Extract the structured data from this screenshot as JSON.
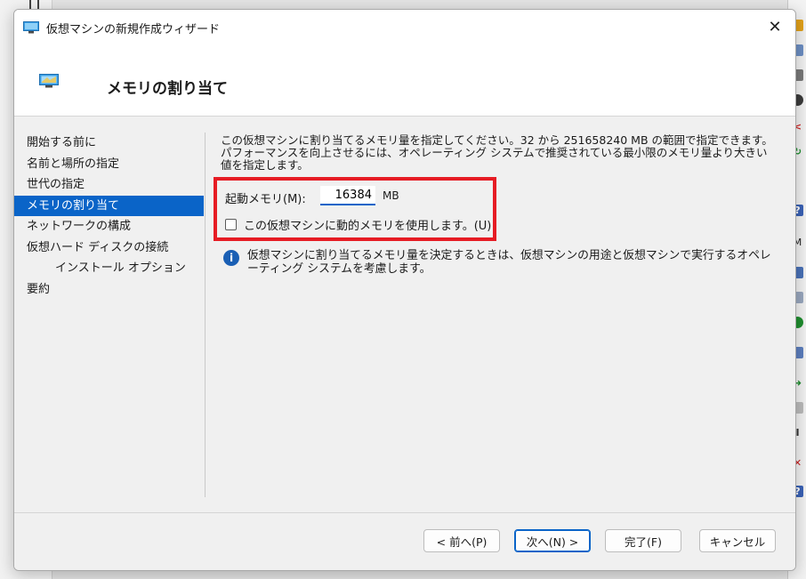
{
  "window": {
    "title": "仮想マシンの新規作成ウィザード",
    "close_glyph": "✕"
  },
  "header": {
    "title": "メモリの割り当て"
  },
  "nav": {
    "items": [
      {
        "label": "開始する前に",
        "active": false
      },
      {
        "label": "名前と場所の指定",
        "active": false
      },
      {
        "label": "世代の指定",
        "active": false
      },
      {
        "label": "メモリの割り当て",
        "active": true
      },
      {
        "label": "ネットワークの構成",
        "active": false
      },
      {
        "label": "仮想ハード ディスクの接続",
        "active": false
      },
      {
        "label": "インストール オプション",
        "active": false
      },
      {
        "label": "要約",
        "active": false
      }
    ]
  },
  "content": {
    "description": "この仮想マシンに割り当てるメモリ量を指定してください。32 から 251658240 MB の範囲で指定できます。パフォーマンスを向上させるには、オペレーティング システムで推奨されている最小限のメモリ量より大きい値を指定します。",
    "startup_memory_label": "起動メモリ(M):",
    "startup_memory_value": "16384",
    "startup_memory_unit": "MB",
    "dynamic_memory_label": "この仮想マシンに動的メモリを使用します。(U)",
    "dynamic_memory_checked": false,
    "info_text": "仮想マシンに割り当てるメモリ量を決定するときは、仮想マシンの用途と仮想マシンで実行するオペレーティング システムを考慮します。"
  },
  "footer": {
    "prev_label": "< 前へ(P)",
    "next_label": "次へ(N) >",
    "finish_label": "完了(F)",
    "cancel_label": "キャンセル"
  },
  "colors": {
    "accent": "#0a64c8",
    "highlight": "#e61c24",
    "info": "#1a5fb4"
  }
}
